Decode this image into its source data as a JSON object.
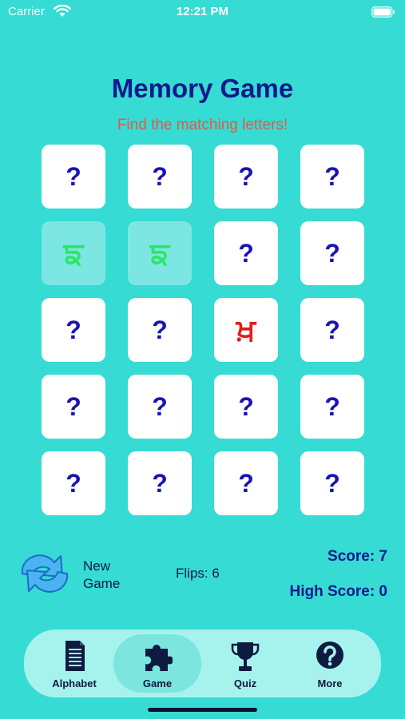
{
  "status": {
    "carrier": "Carrier",
    "time": "12:21 PM"
  },
  "title": "Memory Game",
  "subtitle": "Find the matching letters!",
  "cards": [
    {
      "state": "hidden",
      "text": "?"
    },
    {
      "state": "hidden",
      "text": "?"
    },
    {
      "state": "hidden",
      "text": "?"
    },
    {
      "state": "hidden",
      "text": "?"
    },
    {
      "state": "matched",
      "text": "ਙ",
      "color": "#2ee567"
    },
    {
      "state": "matched",
      "text": "ਙ",
      "color": "#2ee567"
    },
    {
      "state": "hidden",
      "text": "?"
    },
    {
      "state": "hidden",
      "text": "?"
    },
    {
      "state": "hidden",
      "text": "?"
    },
    {
      "state": "hidden",
      "text": "?"
    },
    {
      "state": "revealed",
      "text": "ਖ਼",
      "color": "#e61b1b"
    },
    {
      "state": "hidden",
      "text": "?"
    },
    {
      "state": "hidden",
      "text": "?"
    },
    {
      "state": "hidden",
      "text": "?"
    },
    {
      "state": "hidden",
      "text": "?"
    },
    {
      "state": "hidden",
      "text": "?"
    },
    {
      "state": "hidden",
      "text": "?"
    },
    {
      "state": "hidden",
      "text": "?"
    },
    {
      "state": "hidden",
      "text": "?"
    },
    {
      "state": "hidden",
      "text": "?"
    }
  ],
  "controls": {
    "new_game_label": "New\nGame",
    "flips": "Flips: 6",
    "score": "Score: 7",
    "high_score": "High Score: 0"
  },
  "tabs": [
    {
      "label": "Alphabet",
      "icon": "document-icon",
      "selected": false
    },
    {
      "label": "Game",
      "icon": "puzzle-icon",
      "selected": true
    },
    {
      "label": "Quiz",
      "icon": "trophy-icon",
      "selected": false
    },
    {
      "label": "More",
      "icon": "question-circle-icon",
      "selected": false
    }
  ],
  "colors": {
    "background": "#36dbd3",
    "title": "#101a8c",
    "subtitle": "#e05a4a",
    "question_mark": "#1a14b4",
    "tab_bar": "#a6f3ee"
  }
}
